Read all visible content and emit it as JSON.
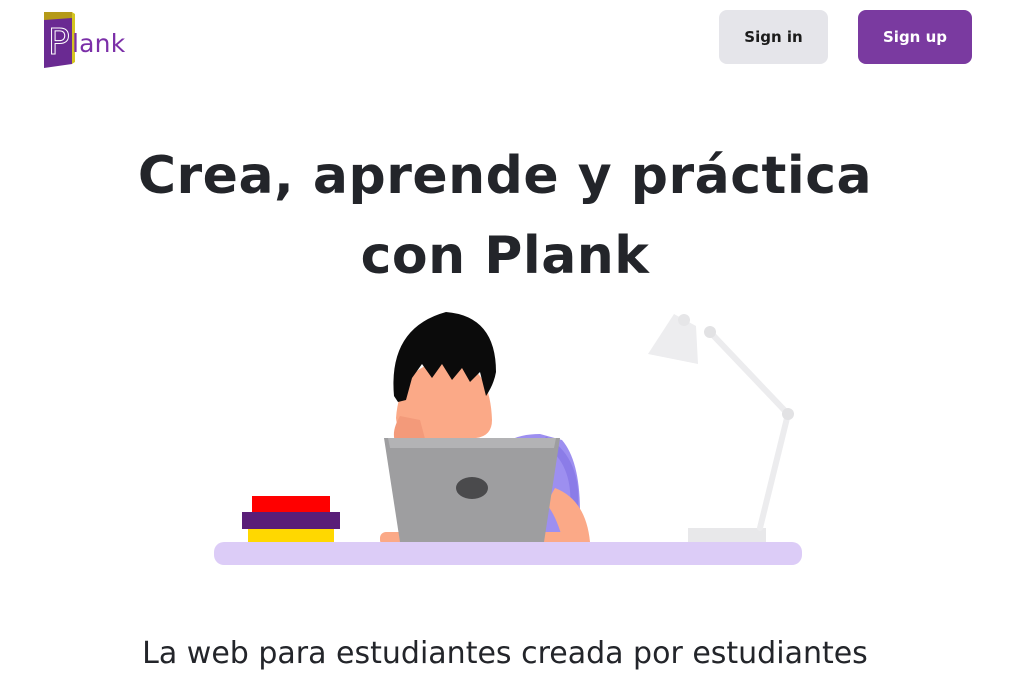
{
  "header": {
    "logo_text": "lank",
    "logo_letter": "P",
    "signin_label": "Sign in",
    "signup_label": "Sign up"
  },
  "hero": {
    "title_line1": "Crea, aprende y práctica",
    "title_line2": "con Plank",
    "subtitle": "La web para estudiantes creada por estudiantes"
  },
  "colors": {
    "brand": "#7a3aa0",
    "signin_bg": "#e5e5ea",
    "text": "#23252a",
    "desk": "#dcccf7"
  }
}
